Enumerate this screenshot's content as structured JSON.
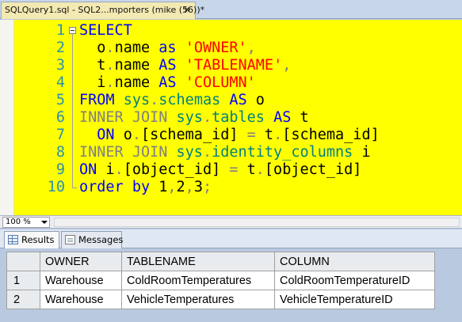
{
  "document_tab": {
    "title": "SQLQuery1.sql - SQL2...mporters (mike (56))*",
    "close_glyph": "✕"
  },
  "editor": {
    "lines": [
      {
        "num": "1",
        "tokens": [
          {
            "t": "SELECT",
            "c": "kw"
          }
        ]
      },
      {
        "num": "2",
        "tokens": [
          {
            "t": "  o",
            "c": "plain"
          },
          {
            "t": ".",
            "c": "gray"
          },
          {
            "t": "name ",
            "c": "plain"
          },
          {
            "t": "as ",
            "c": "kw"
          },
          {
            "t": "'OWNER'",
            "c": "str"
          },
          {
            "t": ",",
            "c": "gray"
          }
        ]
      },
      {
        "num": "3",
        "tokens": [
          {
            "t": "  t",
            "c": "plain"
          },
          {
            "t": ".",
            "c": "gray"
          },
          {
            "t": "name ",
            "c": "plain"
          },
          {
            "t": "AS ",
            "c": "kw"
          },
          {
            "t": "'TABLENAME'",
            "c": "str"
          },
          {
            "t": ",",
            "c": "gray"
          }
        ]
      },
      {
        "num": "4",
        "tokens": [
          {
            "t": "  i",
            "c": "plain"
          },
          {
            "t": ".",
            "c": "gray"
          },
          {
            "t": "name ",
            "c": "plain"
          },
          {
            "t": "AS ",
            "c": "kw"
          },
          {
            "t": "'COLUMN'",
            "c": "str"
          }
        ]
      },
      {
        "num": "5",
        "tokens": [
          {
            "t": "FROM ",
            "c": "kw"
          },
          {
            "t": "sys",
            "c": "fn"
          },
          {
            "t": ".",
            "c": "gray"
          },
          {
            "t": "schemas ",
            "c": "fn"
          },
          {
            "t": "AS ",
            "c": "kw"
          },
          {
            "t": "o",
            "c": "plain"
          }
        ]
      },
      {
        "num": "6",
        "tokens": [
          {
            "t": "INNER JOIN ",
            "c": "gray"
          },
          {
            "t": "sys",
            "c": "fn"
          },
          {
            "t": ".",
            "c": "gray"
          },
          {
            "t": "tables ",
            "c": "fn"
          },
          {
            "t": "AS ",
            "c": "kw"
          },
          {
            "t": "t",
            "c": "plain"
          }
        ]
      },
      {
        "num": "7",
        "tokens": [
          {
            "t": "  ON ",
            "c": "kw"
          },
          {
            "t": "o",
            "c": "plain"
          },
          {
            "t": ".",
            "c": "gray"
          },
          {
            "t": "[schema_id] ",
            "c": "plain"
          },
          {
            "t": "= ",
            "c": "gray"
          },
          {
            "t": "t",
            "c": "plain"
          },
          {
            "t": ".",
            "c": "gray"
          },
          {
            "t": "[schema_id]",
            "c": "plain"
          }
        ]
      },
      {
        "num": "8",
        "tokens": [
          {
            "t": "INNER JOIN ",
            "c": "gray"
          },
          {
            "t": "sys",
            "c": "fn"
          },
          {
            "t": ".",
            "c": "gray"
          },
          {
            "t": "identity_columns ",
            "c": "fn"
          },
          {
            "t": "i",
            "c": "plain"
          }
        ]
      },
      {
        "num": "9",
        "tokens": [
          {
            "t": "ON ",
            "c": "kw"
          },
          {
            "t": "i",
            "c": "plain"
          },
          {
            "t": ".",
            "c": "gray"
          },
          {
            "t": "[object_id] ",
            "c": "plain"
          },
          {
            "t": "= ",
            "c": "gray"
          },
          {
            "t": "t",
            "c": "plain"
          },
          {
            "t": ".",
            "c": "gray"
          },
          {
            "t": "[object_id]",
            "c": "plain"
          }
        ]
      },
      {
        "num": "10",
        "tokens": [
          {
            "t": "order by ",
            "c": "kw"
          },
          {
            "t": "1",
            "c": "plain"
          },
          {
            "t": ",",
            "c": "gray"
          },
          {
            "t": "2",
            "c": "plain"
          },
          {
            "t": ",",
            "c": "gray"
          },
          {
            "t": "3",
            "c": "plain"
          },
          {
            "t": ";",
            "c": "gray"
          }
        ]
      }
    ]
  },
  "zoom": {
    "value": "100 %"
  },
  "results_tabs": {
    "results_label": "Results",
    "messages_label": "Messages"
  },
  "results": {
    "columns": [
      "OWNER",
      "TABLENAME",
      "COLUMN"
    ],
    "rows": [
      {
        "num": "1",
        "cells": [
          "Warehouse",
          "ColdRoomTemperatures",
          "ColdRoomTemperatureID"
        ]
      },
      {
        "num": "2",
        "cells": [
          "Warehouse",
          "VehicleTemperatures",
          "VehicleTemperatureID"
        ]
      }
    ]
  },
  "colors": {
    "editor_background": "#ffff00",
    "keyword": "#0000ff",
    "string": "#ff0000",
    "operator": "#808080",
    "system_object": "#008080",
    "line_number": "#2b91af"
  }
}
